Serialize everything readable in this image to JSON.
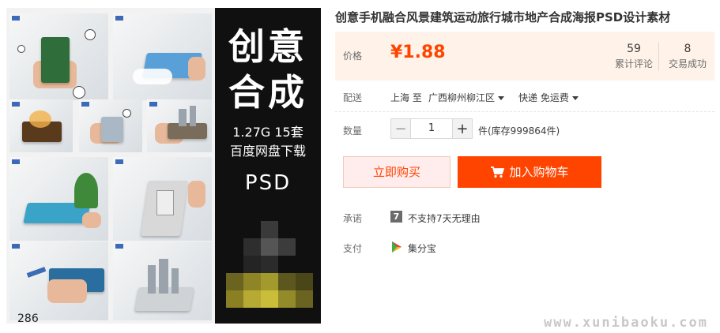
{
  "gallery": {
    "index_label": "286"
  },
  "banner": {
    "line1": "创意",
    "line2": "合成",
    "size_line": "1.27G  15套",
    "download_line": "百度网盘下载",
    "psd_line": "PSD"
  },
  "product": {
    "title": "创意手机融合风景建筑运动旅行城市地产合成海报PSD设计素材"
  },
  "price": {
    "label": "价格",
    "value": "¥1.88",
    "reviews_count": "59",
    "reviews_label": "累计评论",
    "deals_count": "8",
    "deals_label": "交易成功"
  },
  "delivery": {
    "label": "配送",
    "from": "上海 至",
    "to": "广西柳州柳江区",
    "method": "快递 免运费"
  },
  "quantity": {
    "label": "数量",
    "minus": "−",
    "value": "1",
    "plus": "+",
    "stock": "件(库存999864件)"
  },
  "actions": {
    "buy_now": "立即购买",
    "add_to_cart": "加入购物车"
  },
  "promise": {
    "label": "承诺",
    "badge": "7",
    "text": "不支持7天无理由"
  },
  "payment": {
    "label": "支付",
    "text": "集分宝"
  },
  "watermark": "www.xunibaoku.com"
}
